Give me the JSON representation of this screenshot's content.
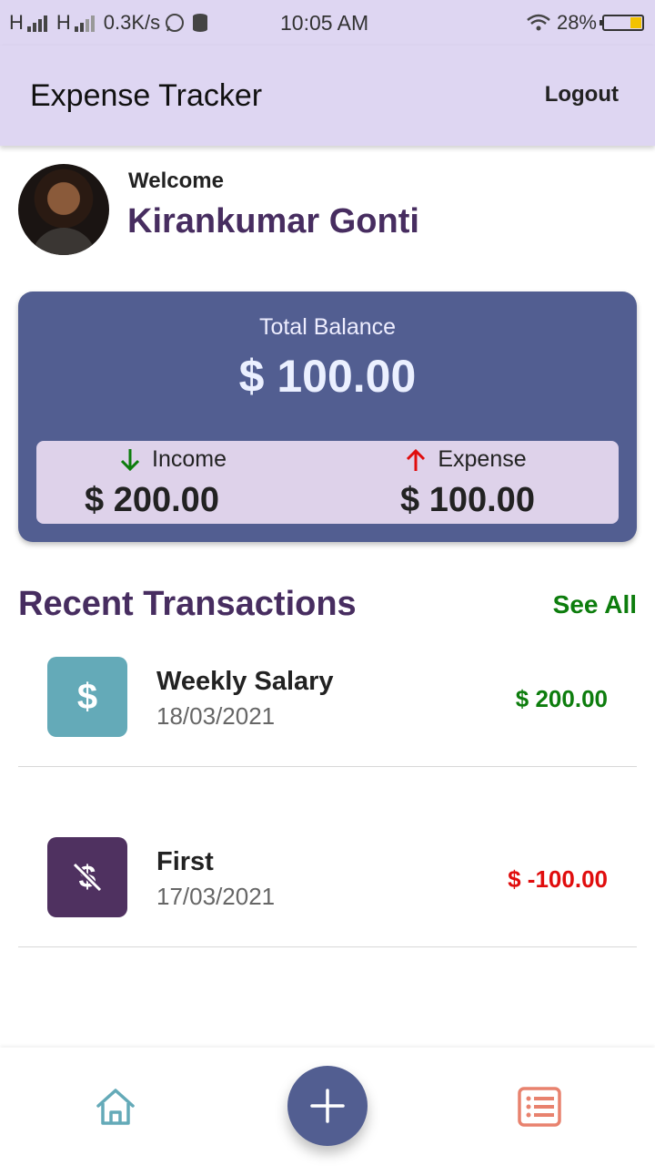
{
  "status_bar": {
    "net1": "H",
    "net2": "H",
    "speed": "0.3K/s",
    "time": "10:05 AM",
    "battery": "28%",
    "battery_level": 0.28
  },
  "app_bar": {
    "title": "Expense Tracker",
    "logout_label": "Logout"
  },
  "user": {
    "welcome": "Welcome",
    "name": "Kirankumar Gonti"
  },
  "balance": {
    "label": "Total Balance",
    "amount": "$ 100.00",
    "income_label": "Income",
    "income_amount": "$ 200.00",
    "expense_label": "Expense",
    "expense_amount": "$ 100.00"
  },
  "recent": {
    "title": "Recent Transactions",
    "see_all": "See All",
    "items": [
      {
        "name": "Weekly Salary",
        "date": "18/03/2021",
        "amount": "$ 200.00",
        "type": "income",
        "icon": "dollar-icon",
        "color": "#64aab8",
        "amount_color": "#0d7d0d"
      },
      {
        "name": "First",
        "date": "17/03/2021",
        "amount": "$ -100.00",
        "type": "expense",
        "icon": "dollar-off-icon",
        "color": "#4f3160",
        "amount_color": "#e00d0d"
      }
    ]
  },
  "colors": {
    "accent": "#525e91",
    "header": "#ded6f2",
    "title_purple": "#472d60",
    "income_green": "#0d7d0d",
    "expense_red": "#e00d0d"
  },
  "nav": {
    "home_icon": "home-icon",
    "add_icon": "plus-icon",
    "list_icon": "list-icon"
  }
}
